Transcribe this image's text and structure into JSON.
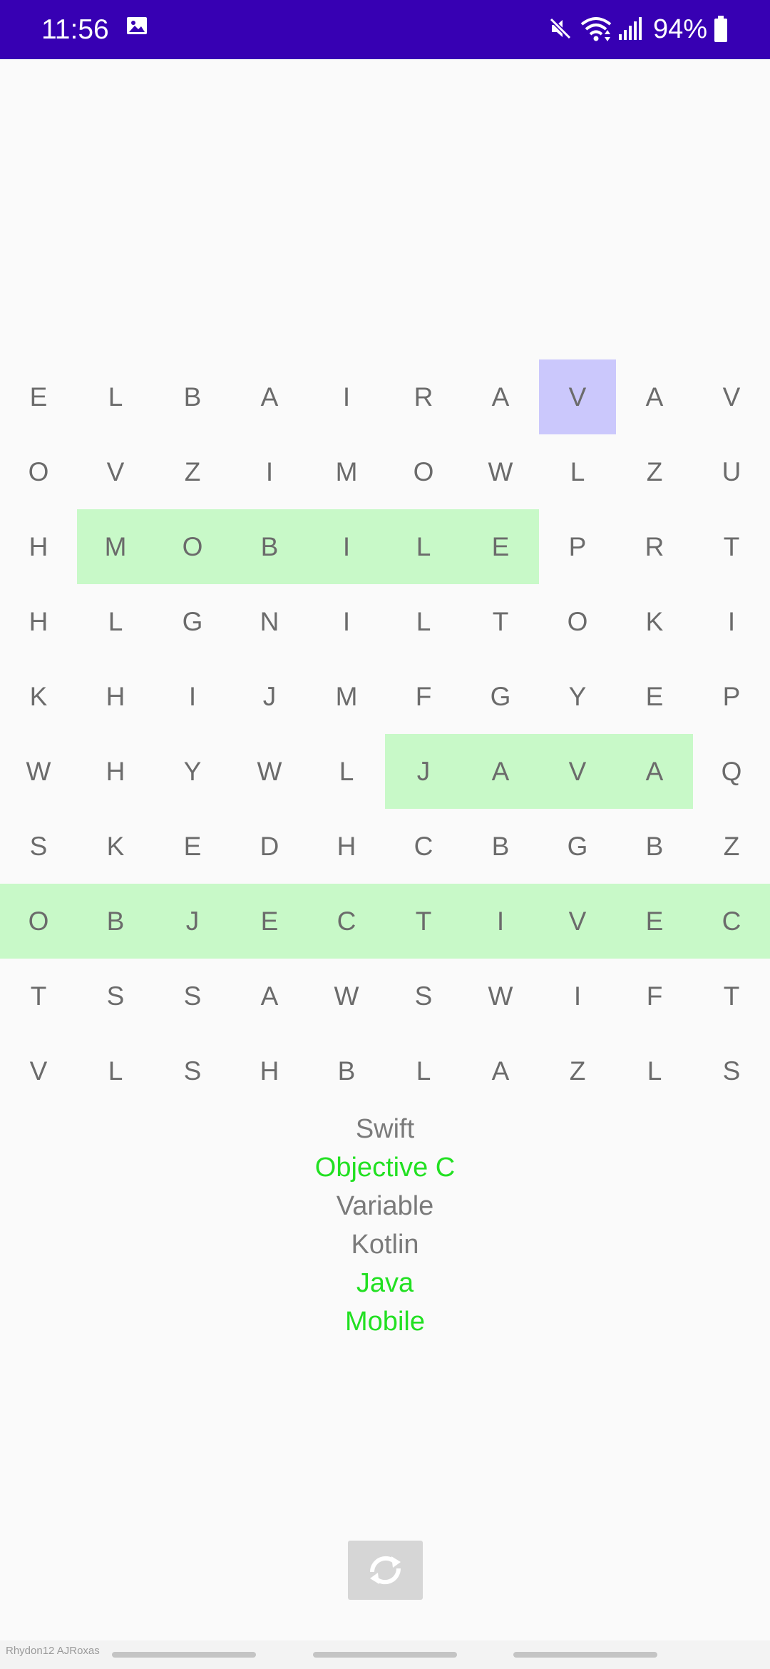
{
  "status_bar": {
    "time": "11:56",
    "battery": "94%",
    "icons": [
      "image-icon",
      "mute-icon",
      "wifi-icon",
      "signal-icon",
      "battery-icon"
    ],
    "background": "#3700b3"
  },
  "grid": {
    "rows": [
      [
        "E",
        "L",
        "B",
        "A",
        "I",
        "R",
        "A",
        "V",
        "A",
        "V"
      ],
      [
        "O",
        "V",
        "Z",
        "I",
        "M",
        "O",
        "W",
        "L",
        "Z",
        "U"
      ],
      [
        "H",
        "M",
        "O",
        "B",
        "I",
        "L",
        "E",
        "P",
        "R",
        "T"
      ],
      [
        "H",
        "L",
        "G",
        "N",
        "I",
        "L",
        "T",
        "O",
        "K",
        "I"
      ],
      [
        "K",
        "H",
        "I",
        "J",
        "M",
        "F",
        "G",
        "Y",
        "E",
        "P"
      ],
      [
        "W",
        "H",
        "Y",
        "W",
        "L",
        "J",
        "A",
        "V",
        "A",
        "Q"
      ],
      [
        "S",
        "K",
        "E",
        "D",
        "H",
        "C",
        "B",
        "G",
        "B",
        "Z"
      ],
      [
        "O",
        "B",
        "J",
        "E",
        "C",
        "T",
        "I",
        "V",
        "E",
        "C"
      ],
      [
        "T",
        "S",
        "S",
        "A",
        "W",
        "S",
        "W",
        "I",
        "F",
        "T"
      ],
      [
        "V",
        "L",
        "S",
        "H",
        "B",
        "L",
        "A",
        "Z",
        "L",
        "S"
      ]
    ],
    "found_highlights": [
      {
        "word": "MOBILE",
        "row": 2,
        "col_start": 1,
        "col_end": 6
      },
      {
        "word": "JAVA",
        "row": 5,
        "col_start": 5,
        "col_end": 8
      },
      {
        "word": "OBJECTIVEC",
        "row": 7,
        "col_start": 0,
        "col_end": 9
      }
    ],
    "selected_cells": [
      {
        "row": 0,
        "col": 7
      }
    ],
    "colors": {
      "found": "#c8f9c8",
      "selected": "#cbc8fc",
      "letter": "#6b6b6b"
    }
  },
  "word_list": [
    {
      "label": "Swift",
      "found": false
    },
    {
      "label": "Objective C",
      "found": true
    },
    {
      "label": "Variable",
      "found": false
    },
    {
      "label": "Kotlin",
      "found": false
    },
    {
      "label": "Java",
      "found": true
    },
    {
      "label": "Mobile",
      "found": true
    }
  ],
  "word_colors": {
    "found": "#22e022",
    "pending": "#7a7a7a"
  },
  "refresh_button": {
    "icon": "refresh-icon"
  },
  "watermark": "Rhydon12 AJRoxas"
}
